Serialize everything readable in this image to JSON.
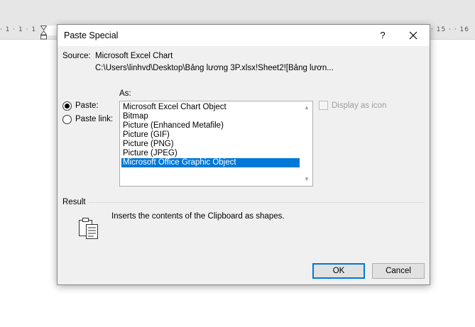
{
  "background": {
    "ruler_left": "· 1 · 1 · 1",
    "ruler_right": "· 15 · · 16"
  },
  "dialog": {
    "title": "Paste Special",
    "help_label": "?",
    "source": {
      "label": "Source:",
      "name": "Microsoft Excel Chart",
      "path": "C:\\Users\\linhvd\\Desktop\\Bảng lương 3P.xlsx!Sheet2![Bảng lươn..."
    },
    "options": {
      "paste_label": "Paste:",
      "paste_link_label": "Paste link:",
      "selected": "paste"
    },
    "as": {
      "label": "As:",
      "items": [
        "Microsoft Excel Chart Object",
        "Bitmap",
        "Picture (Enhanced Metafile)",
        "Picture (GIF)",
        "Picture (PNG)",
        "Picture (JPEG)",
        "Microsoft Office Graphic Object"
      ],
      "selected_index": 6
    },
    "display_as_icon": {
      "label": "Display as icon",
      "checked": false,
      "enabled": false
    },
    "result": {
      "label": "Result",
      "description": "Inserts the contents of the Clipboard as shapes."
    },
    "buttons": {
      "ok": "OK",
      "cancel": "Cancel"
    }
  },
  "colors": {
    "accent": "#0078d7",
    "dialog_bg": "#f0f0f0",
    "disabled_text": "#9d9d9d"
  }
}
